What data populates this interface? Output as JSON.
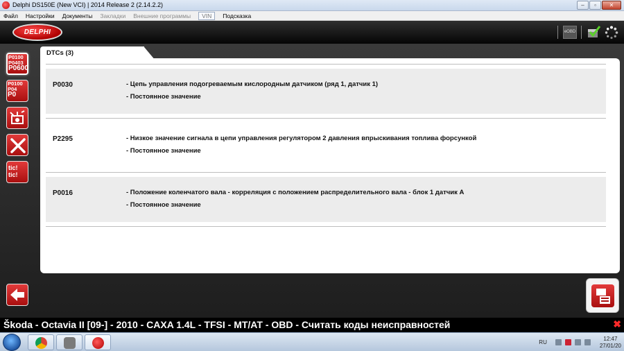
{
  "window": {
    "title": "Delphi DS150E (New VCI) | 2014 Release 2 (2.14.2.2)",
    "buttons": {
      "minimize": "‒",
      "maximize": "▫",
      "close": "✕"
    }
  },
  "menu": {
    "items": [
      {
        "label": "Файл",
        "state": "enabled"
      },
      {
        "label": "Настройки",
        "state": "enabled"
      },
      {
        "label": "Документы",
        "state": "enabled"
      },
      {
        "label": "Закладки",
        "state": "disabled"
      },
      {
        "label": "Внешние программы",
        "state": "disabled"
      },
      {
        "label": "VIN",
        "state": "boxed"
      },
      {
        "label": "Подсказка",
        "state": "enabled"
      }
    ]
  },
  "header": {
    "logo_text": "DELPHI",
    "obd_label": "eOBD"
  },
  "sidebar": {
    "dtc_codes_lines": [
      "P0100",
      "P0403",
      "P0600"
    ],
    "freeze_codes_lines": [
      "P0100",
      "P04",
      "P0"
    ],
    "tic_label": "tic! tic!"
  },
  "panel": {
    "tab_title": "DTCs (3)"
  },
  "dtcs": [
    {
      "code": "P0030",
      "description": "- Цепь управления подогреваемым кислородным датчиком (ряд 1, датчик 1)",
      "status": "- Постоянное значение"
    },
    {
      "code": "P2295",
      "description": "- Низкое значение сигнала в цепи управления регулятором 2 давления впрыскивания топлива форсункой",
      "status": "- Постоянное значение"
    },
    {
      "code": "P0016",
      "description": "- Положение коленчатого вала - корреляция с положением распределительного вала - блок 1 датчик А",
      "status": "- Постоянное значение"
    }
  ],
  "statusbar": {
    "text": "Škoda - Octavia II [09-] - 2010 - CAXA 1.4L - TFSI - MT/AT - OBD - Считать коды неисправностей",
    "close": "✖"
  },
  "taskbar": {
    "language": "RU",
    "time": "12:47",
    "date": "27/01/20"
  },
  "colors": {
    "brand_red": "#c41010",
    "header_bg": "#111111",
    "row_bg": "#ececec"
  }
}
